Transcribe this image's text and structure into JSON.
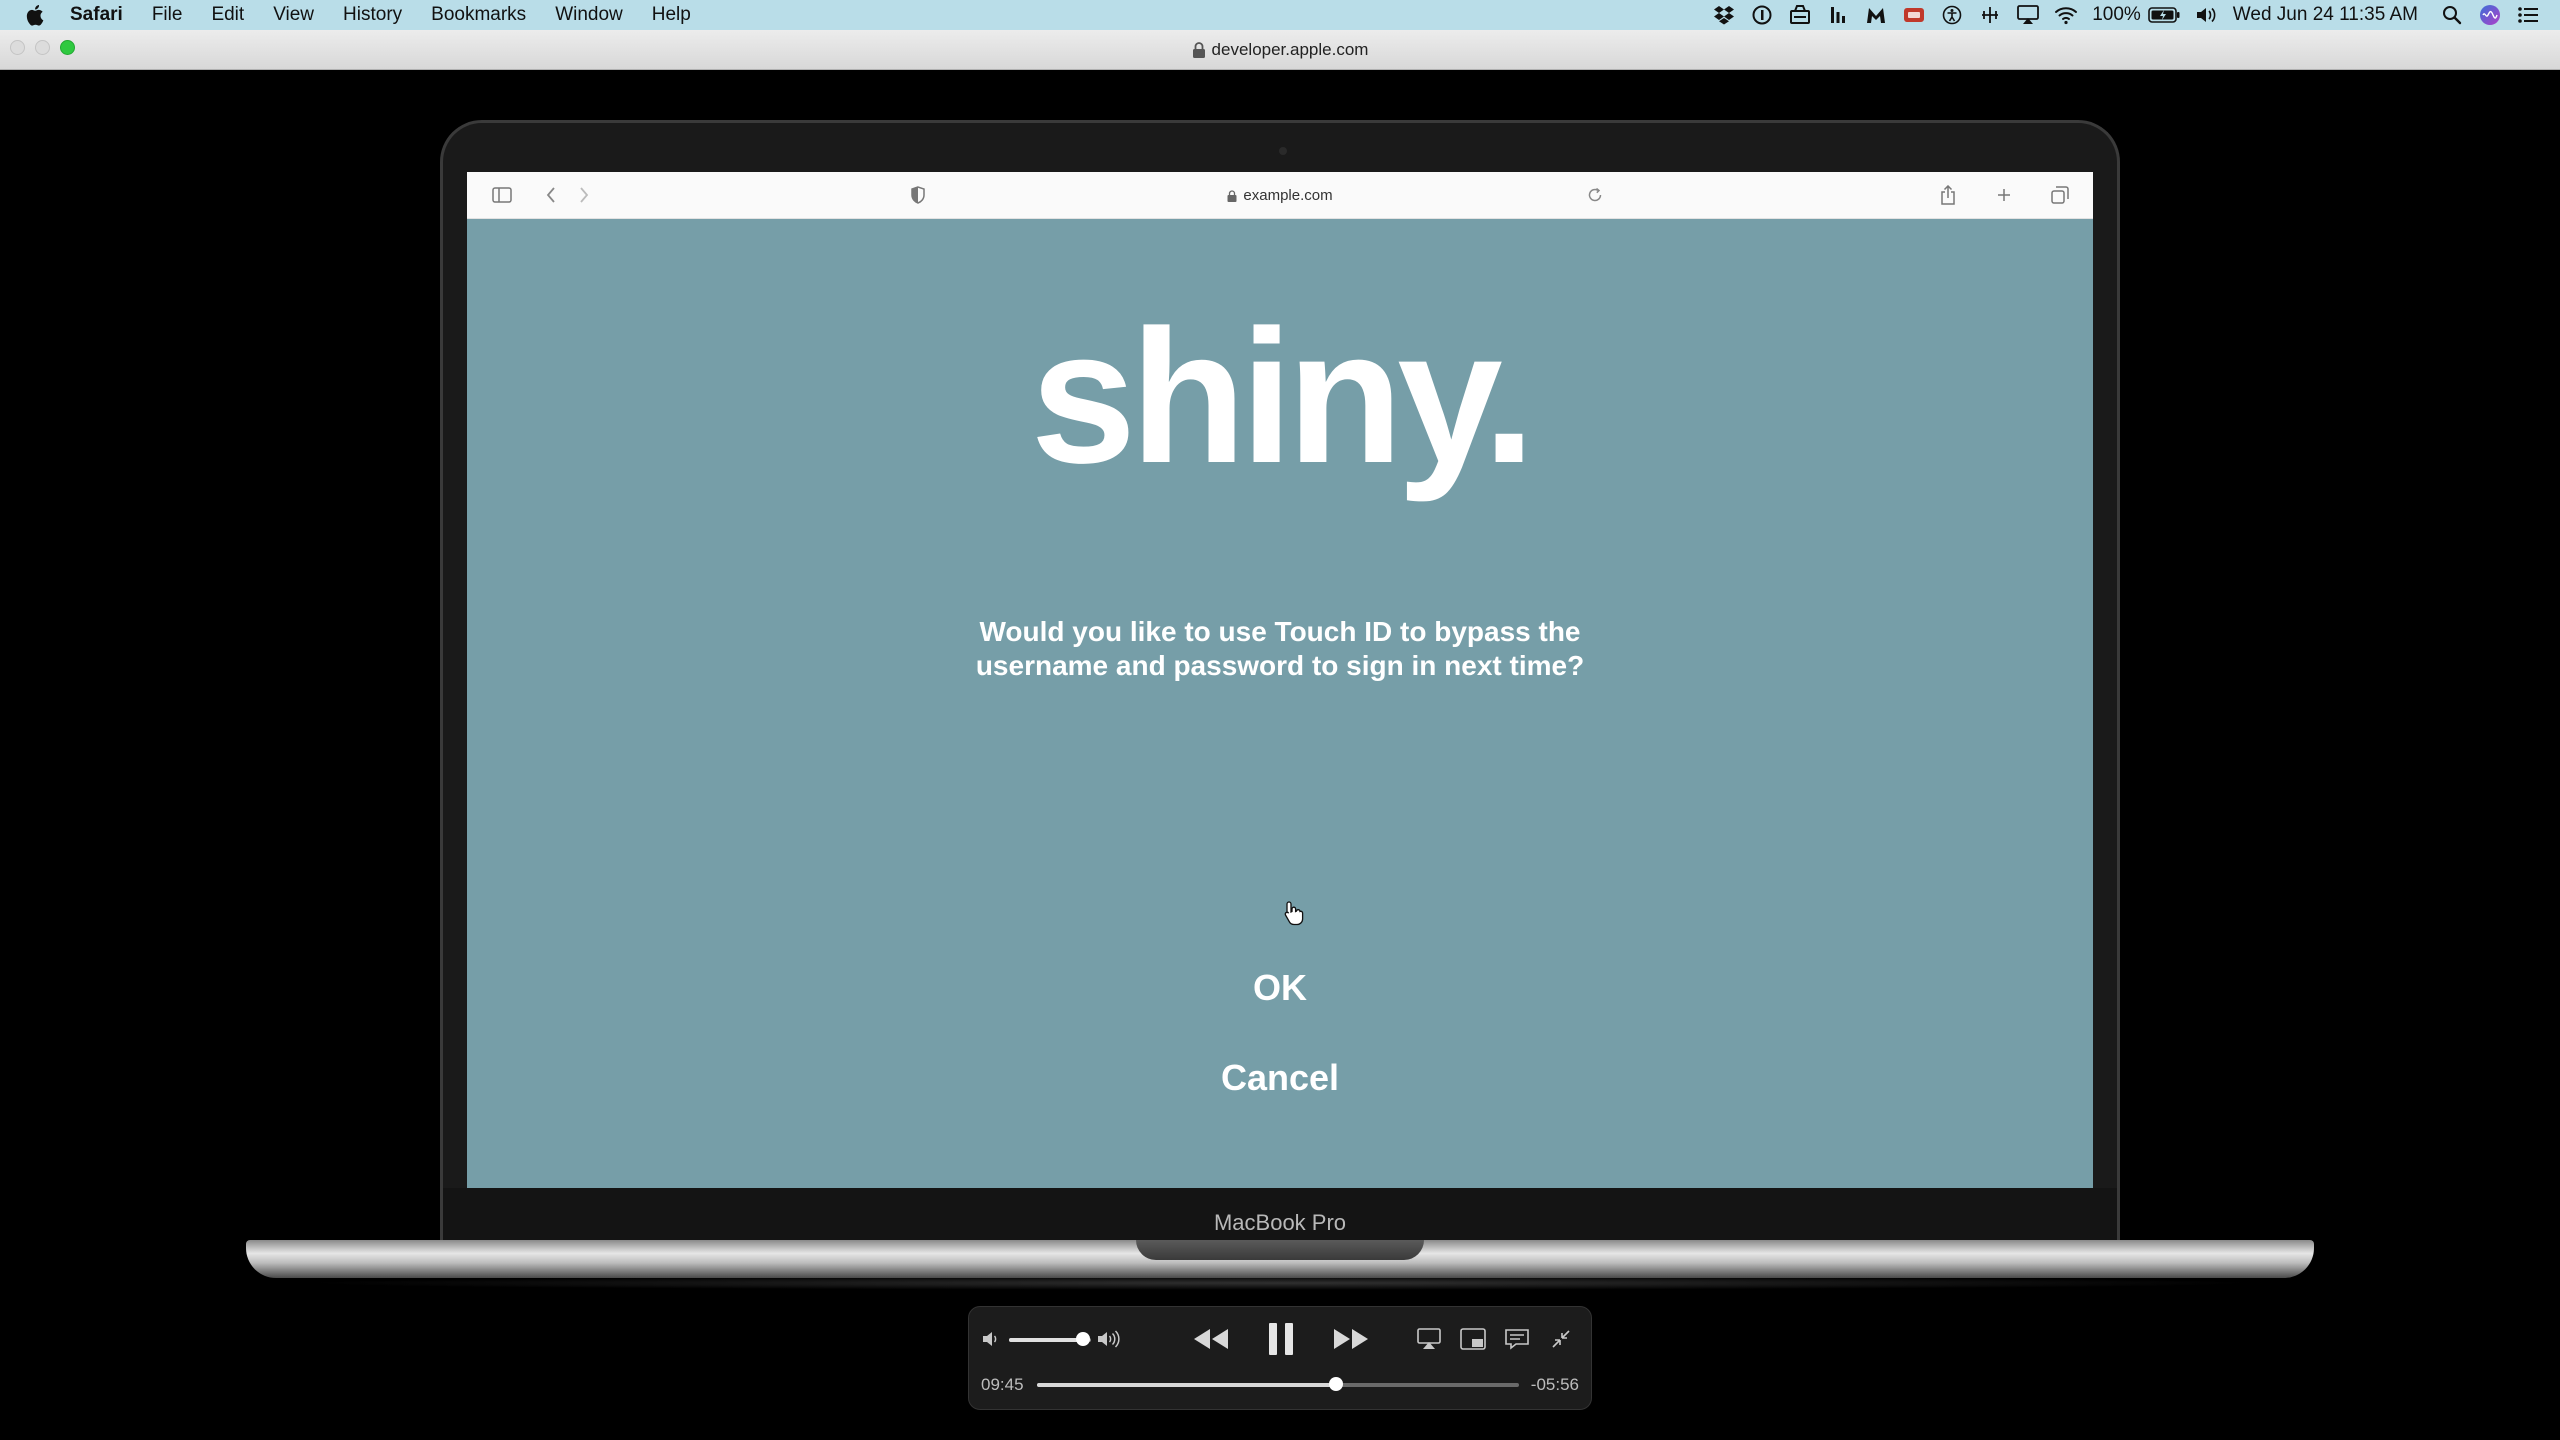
{
  "menubar": {
    "app_name": "Safari",
    "items": [
      "File",
      "Edit",
      "View",
      "History",
      "Bookmarks",
      "Window",
      "Help"
    ],
    "status_icons": [
      "dropbox-icon",
      "onepassword-icon",
      "tools-icon",
      "bars-icon",
      "malwarebytes-icon",
      "display-icon",
      "accessibility-icon",
      "sound-control-icon",
      "airplay-icon",
      "wifi-icon"
    ],
    "battery": "100%",
    "datetime": "Wed Jun 24  11:35 AM"
  },
  "window": {
    "url": "developer.apple.com"
  },
  "video": {
    "laptop_label": "MacBook Pro",
    "inner_browser": {
      "url": "example.com"
    },
    "page": {
      "headline": "shiny.",
      "prompt": "Would you like to use Touch ID to bypass the username and password to sign in next time?",
      "ok_label": "OK",
      "cancel_label": "Cancel",
      "background": "#769ea8"
    }
  },
  "player": {
    "elapsed": "09:45",
    "remaining": "-05:56",
    "progress": 0.62,
    "volume": 0.9
  }
}
